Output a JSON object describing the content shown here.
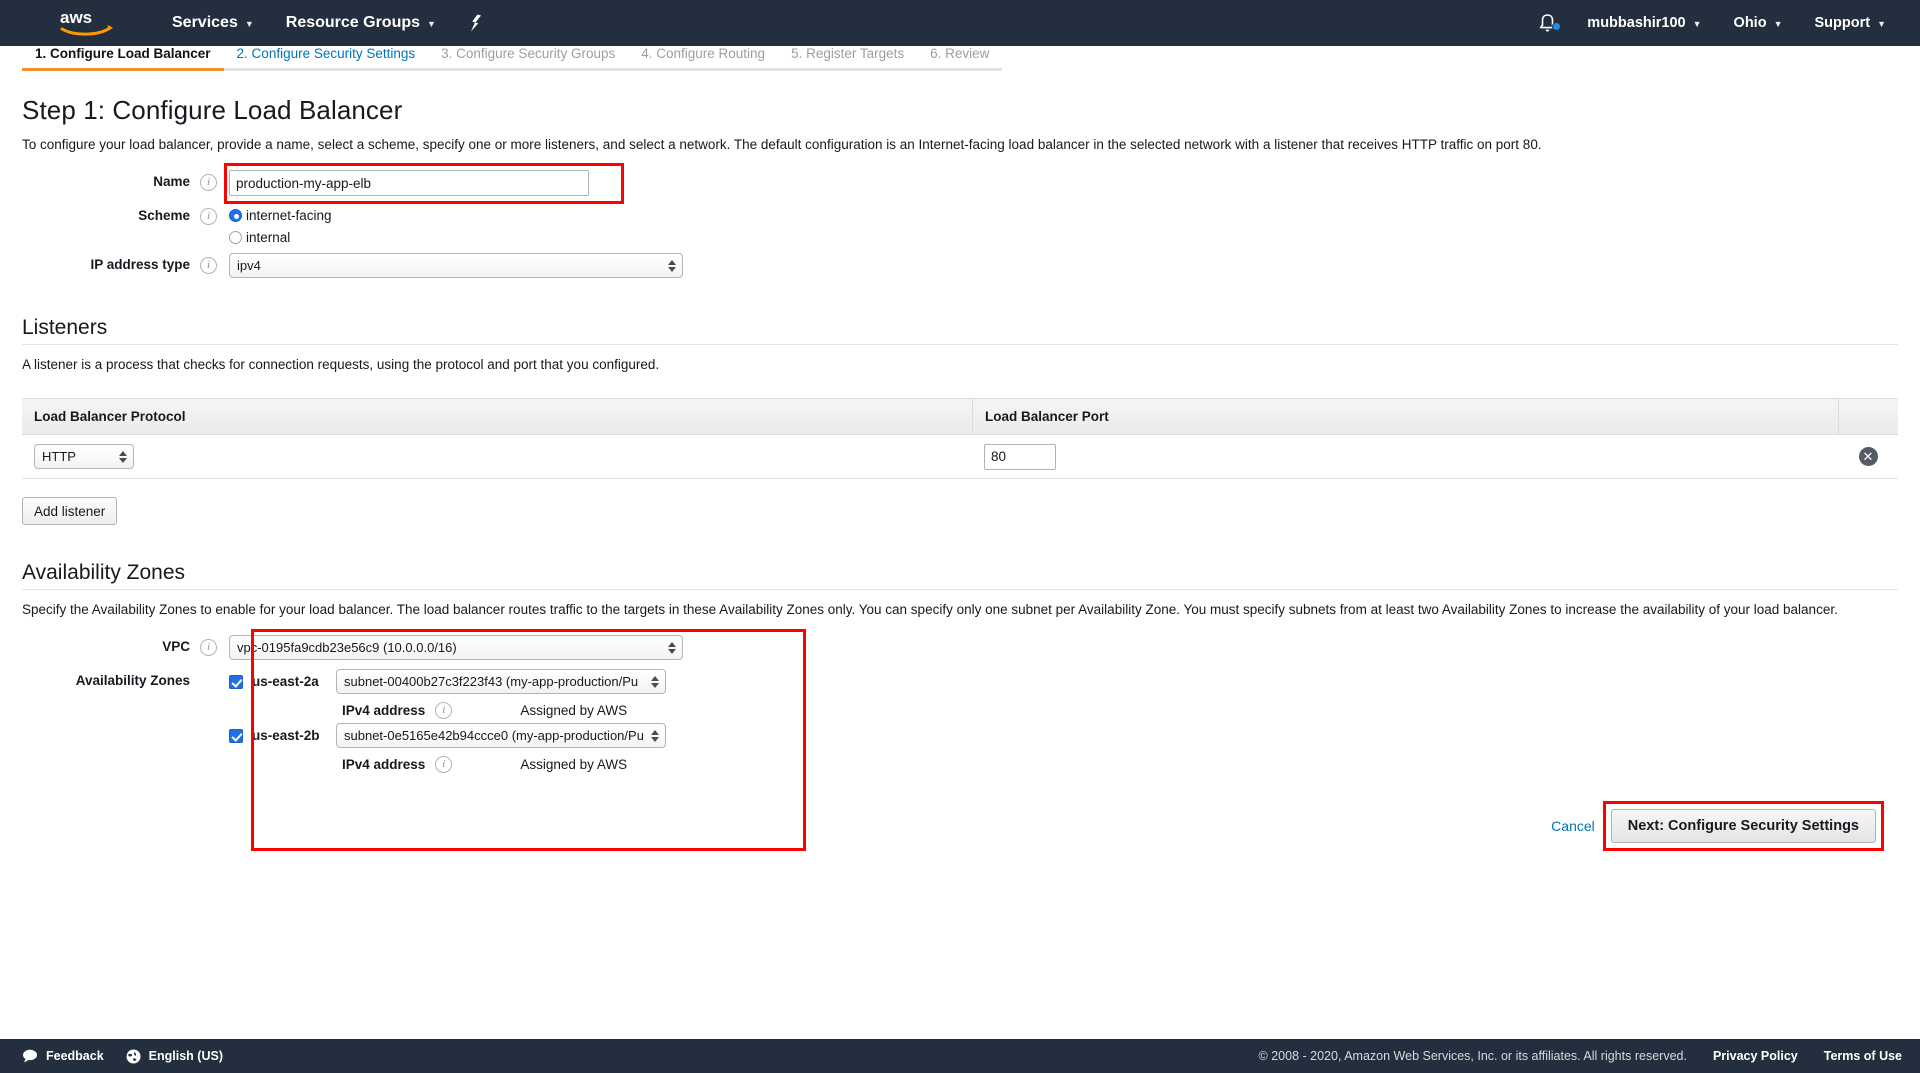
{
  "topnav": {
    "logo_alt": "aws",
    "services": "Services",
    "resource_groups": "Resource Groups",
    "account": "mubbashir100",
    "region": "Ohio",
    "support": "Support",
    "bg_color": "#232f3e",
    "notification_dot_color": "#1f8ceb"
  },
  "wizard_tabs": [
    {
      "label": "1. Configure Load Balancer",
      "state": "active"
    },
    {
      "label": "2. Configure Security Settings",
      "state": "next"
    },
    {
      "label": "3. Configure Security Groups",
      "state": "disabled"
    },
    {
      "label": "4. Configure Routing",
      "state": "disabled"
    },
    {
      "label": "5. Register Targets",
      "state": "disabled"
    },
    {
      "label": "6. Review",
      "state": "disabled"
    }
  ],
  "accent_color": "#ec912d",
  "link_color": "#0073bb",
  "annotation_color": "#ff0000",
  "page": {
    "title": "Step 1: Configure Load Balancer",
    "description": "To configure your load balancer, provide a name, select a scheme, specify one or more listeners, and select a network. The default configuration is an Internet-facing load balancer in the selected network with a listener that receives HTTP traffic on port 80."
  },
  "basic_config": {
    "name_label": "Name",
    "name_value": "production-my-app-elb",
    "name_placeholder": "",
    "scheme_label": "Scheme",
    "scheme_options": [
      {
        "label": "internet-facing",
        "selected": true
      },
      {
        "label": "internal",
        "selected": false
      }
    ],
    "ip_type_label": "IP address type",
    "ip_type_value": "ipv4"
  },
  "listeners": {
    "heading": "Listeners",
    "description": "A listener is a process that checks for connection requests, using the protocol and port that you configured.",
    "columns": [
      "Load Balancer Protocol",
      "Load Balancer Port"
    ],
    "rows": [
      {
        "protocol": "HTTP",
        "port": "80",
        "delete_icon": "close-circle-icon"
      }
    ],
    "add_button": "Add listener"
  },
  "availability_zones": {
    "heading": "Availability Zones",
    "description": "Specify the Availability Zones to enable for your load balancer. The load balancer routes traffic to the targets in these Availability Zones only. You can specify only one subnet per Availability Zone. You must specify subnets from at least two Availability Zones to increase the availability of your load balancer.",
    "vpc_label": "VPC",
    "vpc_value": "vpc-0195fa9cdb23e56c9 (10.0.0.0/16)",
    "az_label": "Availability Zones",
    "ipv4_label": "IPv4 address",
    "ipv4_value": "Assigned by AWS",
    "zones": [
      {
        "checked": true,
        "name": "us-east-2a",
        "subnet": "subnet-00400b27c3f223f43 (my-app-production/Pu"
      },
      {
        "checked": true,
        "name": "us-east-2b",
        "subnet": "subnet-0e5165e42b94ccce0 (my-app-production/Pu"
      }
    ]
  },
  "actions": {
    "cancel": "Cancel",
    "next": "Next: Configure Security Settings"
  },
  "footer": {
    "feedback": "Feedback",
    "language": "English (US)",
    "copyright": "© 2008 - 2020, Amazon Web Services, Inc. or its affiliates. All rights reserved.",
    "privacy": "Privacy Policy",
    "terms": "Terms of Use"
  }
}
